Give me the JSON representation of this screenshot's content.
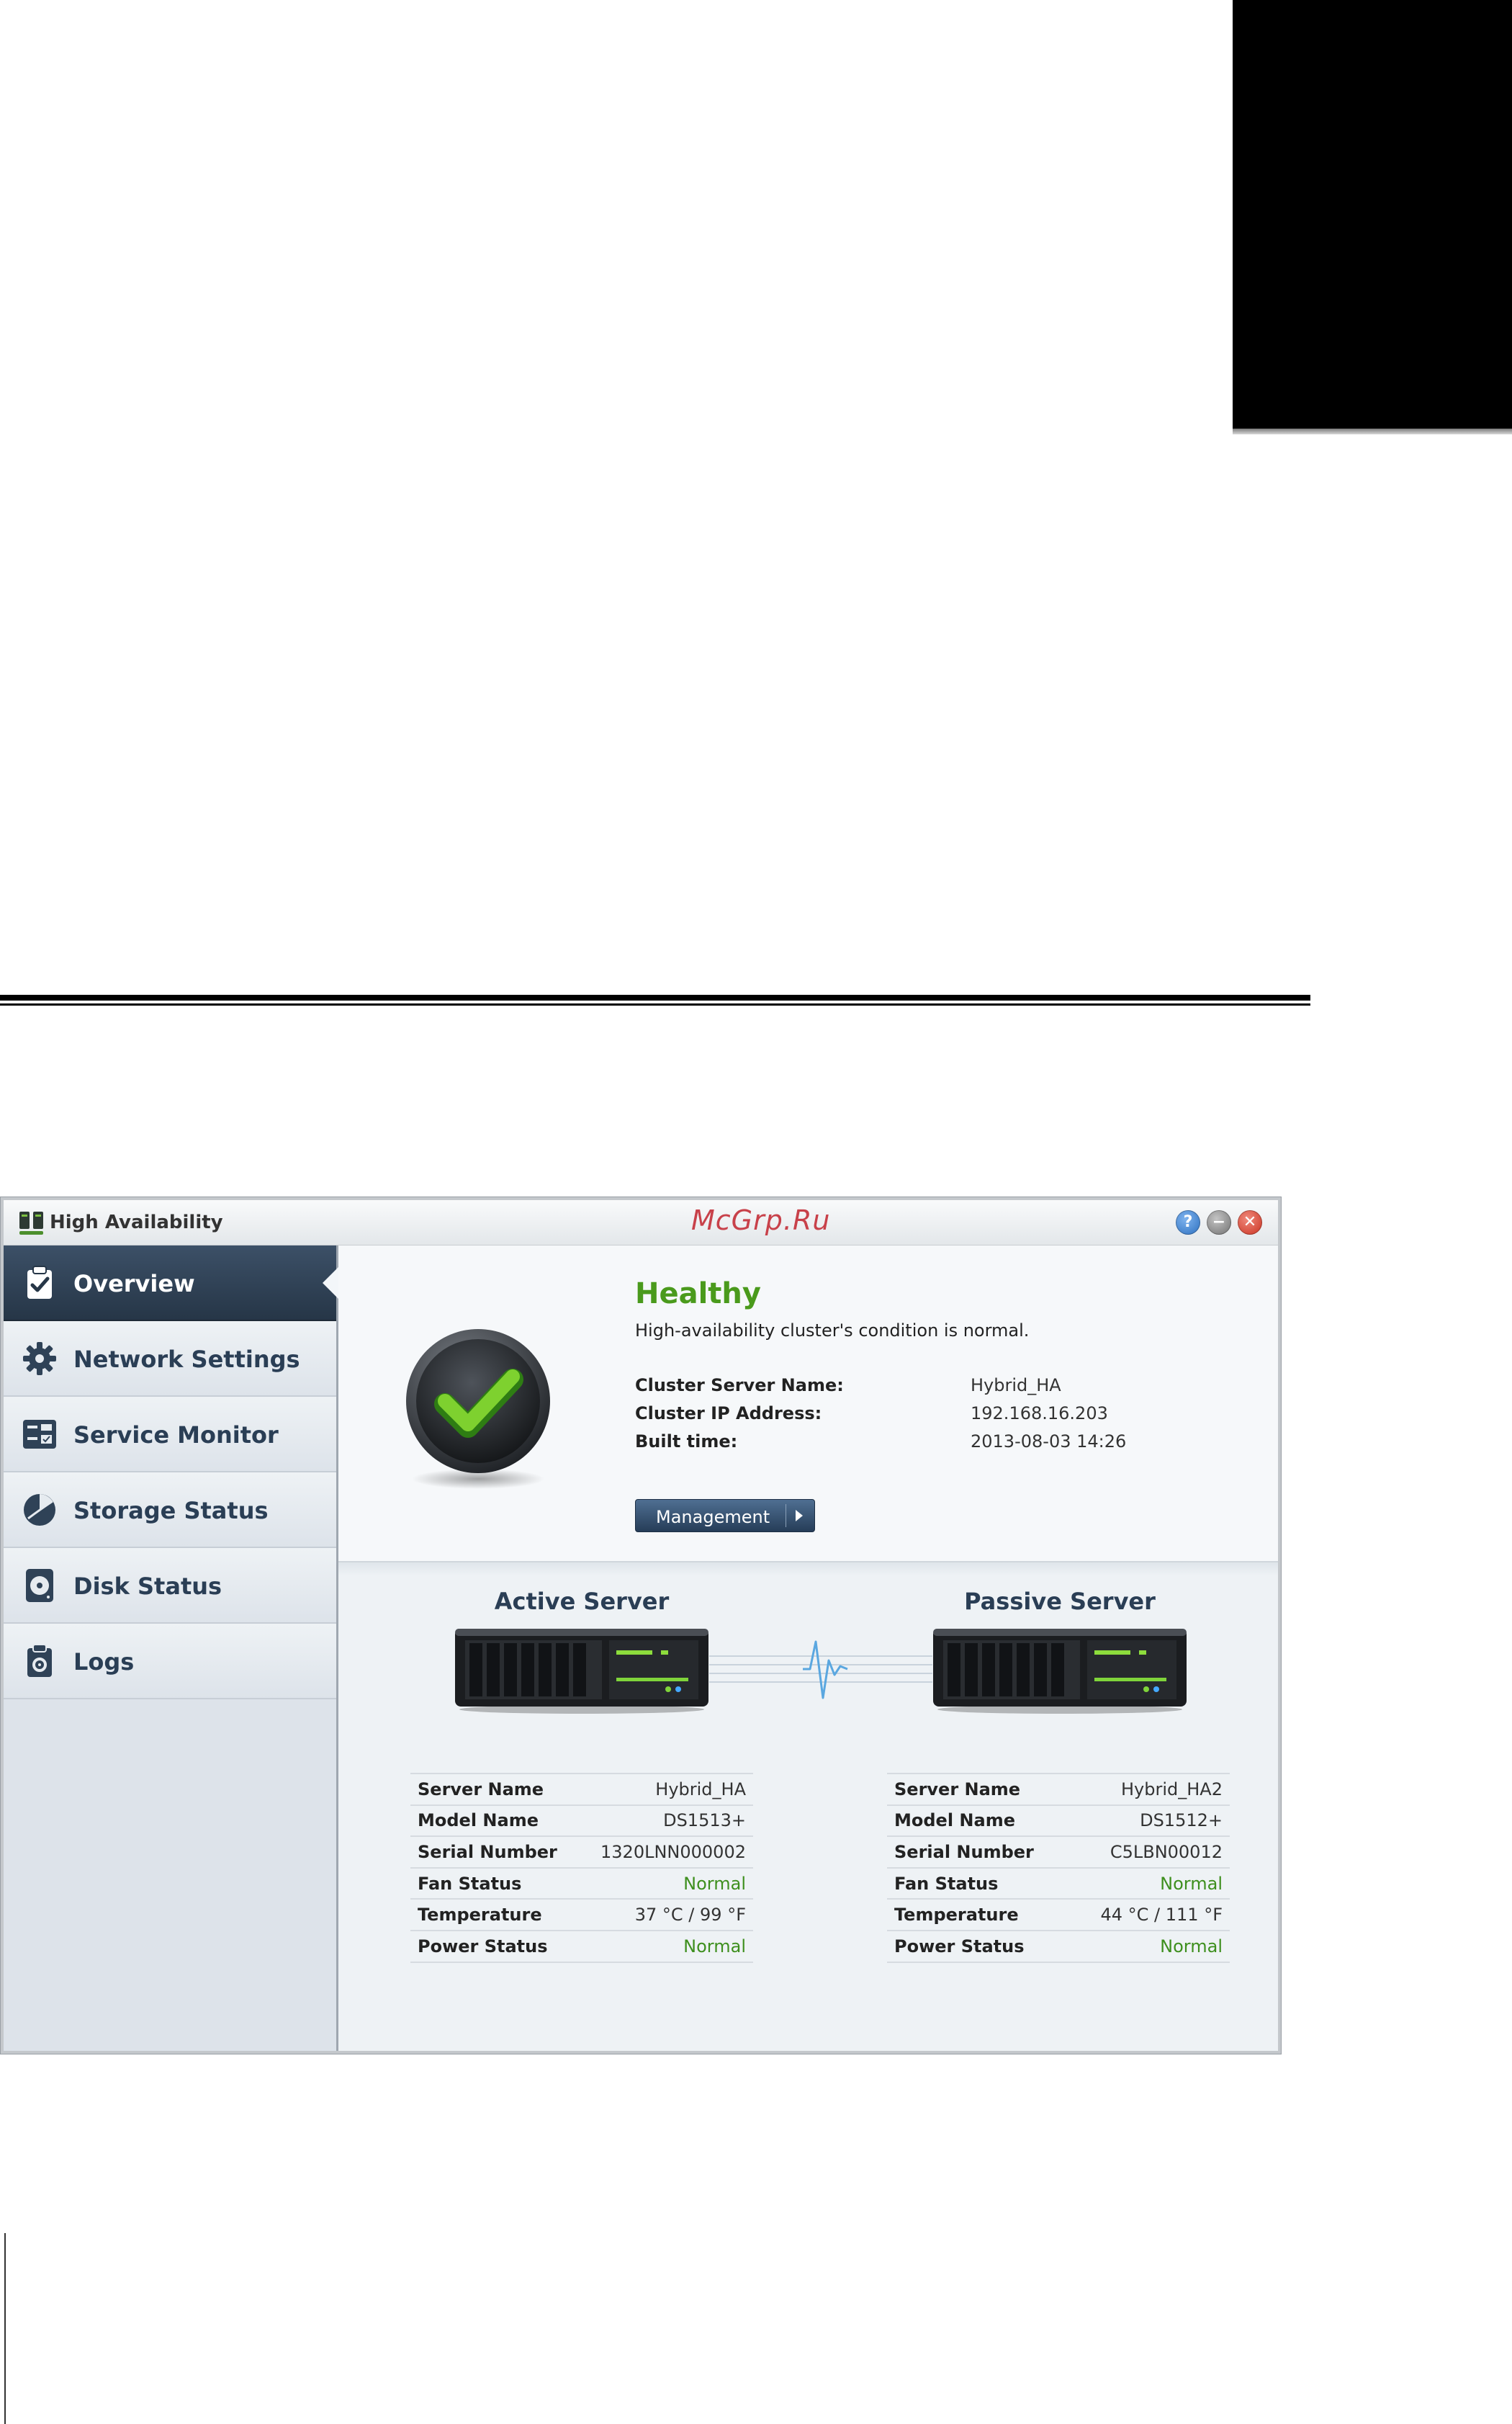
{
  "window": {
    "title": "High Availability",
    "watermark": "McGrp.Ru",
    "buttons": {
      "help": "?",
      "minimize": "",
      "close": "✕"
    }
  },
  "sidebar": {
    "items": [
      {
        "label": "Overview",
        "icon": "clipboard-check-icon",
        "active": true
      },
      {
        "label": "Network Settings",
        "icon": "gear-icon",
        "active": false
      },
      {
        "label": "Service Monitor",
        "icon": "service-panel-icon",
        "active": false
      },
      {
        "label": "Storage Status",
        "icon": "pie-gauge-icon",
        "active": false
      },
      {
        "label": "Disk Status",
        "icon": "disk-icon",
        "active": false
      },
      {
        "label": "Logs",
        "icon": "clipboard-gear-icon",
        "active": false
      }
    ]
  },
  "overview": {
    "status_icon": "green-checkmark-icon",
    "status_title": "Healthy",
    "status_description": "High-availability cluster's condition is normal.",
    "info": [
      {
        "label": "Cluster Server Name:",
        "value": "Hybrid_HA"
      },
      {
        "label": "Cluster IP Address:",
        "value": "192.168.16.203"
      },
      {
        "label": "Built time:",
        "value": "2013-08-03 14:26"
      }
    ],
    "management_button": "Management"
  },
  "servers": {
    "active": {
      "heading": "Active Server",
      "specs": [
        {
          "label": "Server Name",
          "value": "Hybrid_HA"
        },
        {
          "label": "Model Name",
          "value": "DS1513+"
        },
        {
          "label": "Serial Number",
          "value": "1320LNN000002"
        },
        {
          "label": "Fan Status",
          "value": "Normal"
        },
        {
          "label": "Temperature",
          "value": "37 °C / 99 °F"
        },
        {
          "label": "Power Status",
          "value": "Normal"
        }
      ]
    },
    "passive": {
      "heading": "Passive Server",
      "specs": [
        {
          "label": "Server Name",
          "value": "Hybrid_HA2"
        },
        {
          "label": "Model Name",
          "value": "DS1512+"
        },
        {
          "label": "Serial Number",
          "value": "C5LBN00012"
        },
        {
          "label": "Fan Status",
          "value": "Normal"
        },
        {
          "label": "Temperature",
          "value": "44 °C / 111 °F"
        },
        {
          "label": "Power Status",
          "value": "Normal"
        }
      ]
    }
  },
  "colors": {
    "healthy_green": "#4a9a1c",
    "normal_green": "#3e8f1e",
    "nav_active": "#2f4257",
    "nav_text": "#2a3e55"
  }
}
